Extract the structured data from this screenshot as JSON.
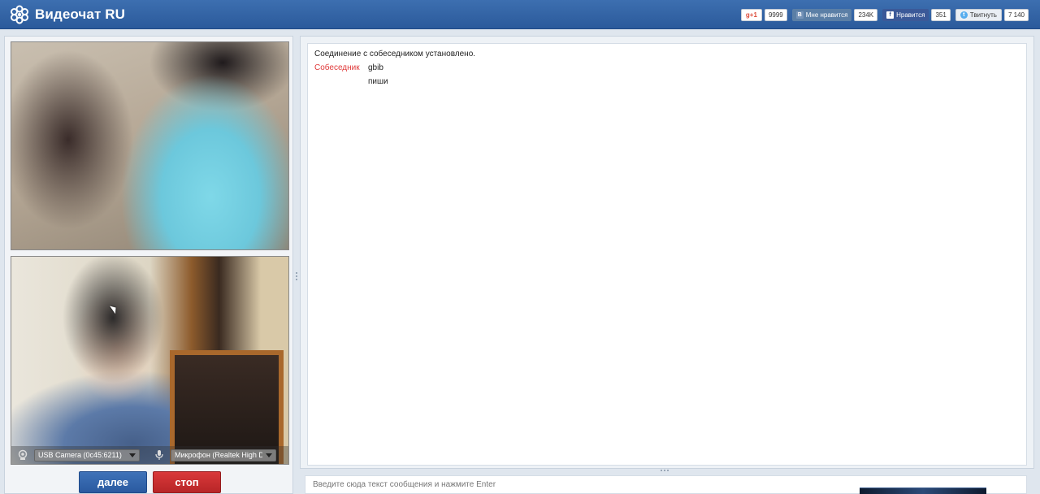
{
  "header": {
    "brand": "Видеочат RU",
    "logo_icon": "flower-logo-icon",
    "social": {
      "gplus": {
        "label": "g+1",
        "count": "9999"
      },
      "vk": {
        "label": "Мне нравится",
        "icon": "В",
        "count": "234K"
      },
      "fb": {
        "label": "Нравится",
        "icon": "f",
        "count": "351"
      },
      "tw": {
        "label": "Твитнуть",
        "icon": "t",
        "count": "7 140"
      }
    }
  },
  "video": {
    "camera": {
      "icon": "webcam-icon",
      "value": "USB Camera (0c45:6211)"
    },
    "microphone": {
      "icon": "microphone-icon",
      "value": "Микрофон (Realtek High Definition Audio)"
    }
  },
  "controls": {
    "next_label": "далее",
    "stop_label": "стоп"
  },
  "chat": {
    "system_message": "Соединение с собеседником установлено.",
    "messages": [
      {
        "sender": "Собеседник",
        "text": "gbib"
      },
      {
        "sender": "",
        "text": "пиши"
      }
    ],
    "input_placeholder": "Введите сюда текст сообщения и нажмите Enter"
  },
  "colors": {
    "header_blue": "#2f62a6",
    "next_button": "#2f62a8",
    "stop_button": "#cc2f30",
    "sender_red": "#e03a3a"
  }
}
